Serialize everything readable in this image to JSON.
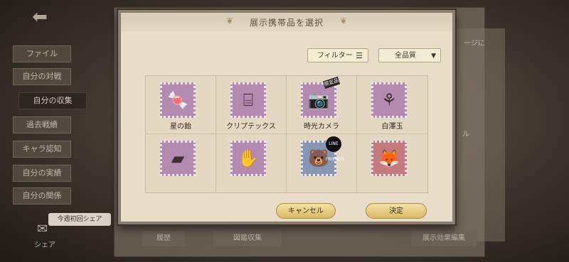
{
  "background": {
    "sidebar": [
      {
        "label": "ファイル"
      },
      {
        "label": "自分の対戦"
      },
      {
        "label": "自分の収集"
      },
      {
        "label": "過去戦績"
      },
      {
        "label": "キャラ認知"
      },
      {
        "label": "自分の実績"
      },
      {
        "label": "自分の関係"
      }
    ],
    "share_tooltip": "今週初回シェア",
    "share_label": "シェア",
    "bottom_buttons": [
      "履歴",
      "図鑑収集",
      "展示効果編集"
    ],
    "right_text_1": "ージに",
    "right_text_2": "ル"
  },
  "dialog": {
    "title": "展示携帯品を選択",
    "filter_label": "フィルター",
    "quality_label": "全品質",
    "items": [
      {
        "name": "星の飴",
        "icon": "candy-jar-icon",
        "color": "purple"
      },
      {
        "name": "クリプテックス",
        "icon": "cryptex-icon",
        "color": "purple"
      },
      {
        "name": "時光カメラ",
        "icon": "camera-icon",
        "color": "purple",
        "tag": "限定品"
      },
      {
        "name": "白澤玉",
        "icon": "jade-pendant-icon",
        "color": "purple"
      },
      {
        "name": "",
        "icon": "device-icon",
        "color": "purple"
      },
      {
        "name": "",
        "icon": "glove-icon",
        "color": "purple"
      },
      {
        "name": "",
        "icon": "plush-charm-icon",
        "color": "blue",
        "badge": "LINE FRIENDS"
      },
      {
        "name": "",
        "icon": "red-plush-icon",
        "color": "red"
      }
    ],
    "cancel_label": "キャンセル",
    "confirm_label": "決定"
  },
  "colors": {
    "dialog_bg": "#e8ddc9",
    "button_gold": "#d9b963",
    "stamp_purple": "#b48bb0"
  }
}
